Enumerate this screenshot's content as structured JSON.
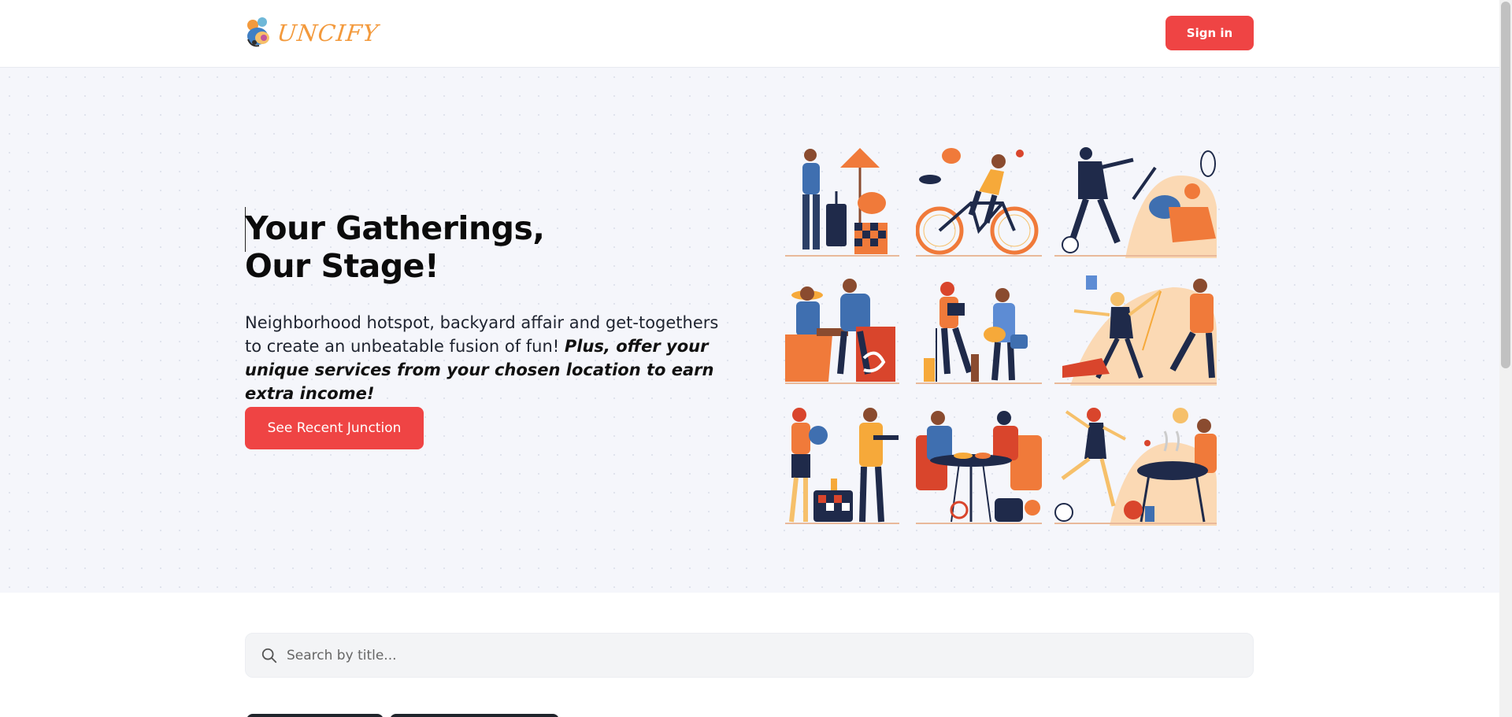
{
  "header": {
    "logo_text": "UNCIFY",
    "signin_label": "Sign in"
  },
  "hero": {
    "title_line1": "Your Gatherings,",
    "title_line2": "Our Stage!",
    "description_plain": "Neighborhood hotspot, backyard affair and get-togethers to create an unbeatable fusion of fun! ",
    "description_emphasis": "Plus, offer your unique services from your chosen location to earn extra income!",
    "cta_label": "See Recent Junction"
  },
  "search": {
    "placeholder": "Search by title..."
  },
  "colors": {
    "accent": "#ef4444",
    "hero_bg": "#f5f6fb",
    "logo_orange": "#f39a3d",
    "illus_orange": "#f07a3a",
    "illus_navy": "#1f2a4a"
  },
  "illustrations": [
    "person-with-luggage-icon",
    "cyclist-icon",
    "soccer-player-icon",
    "people-at-table-icon",
    "woman-reading-man-guitar-icon",
    "woman-dancing-icon",
    "woman-with-ball-man-with-tray-icon",
    "couple-dining-icon",
    "woman-running-barbecue-icon"
  ]
}
